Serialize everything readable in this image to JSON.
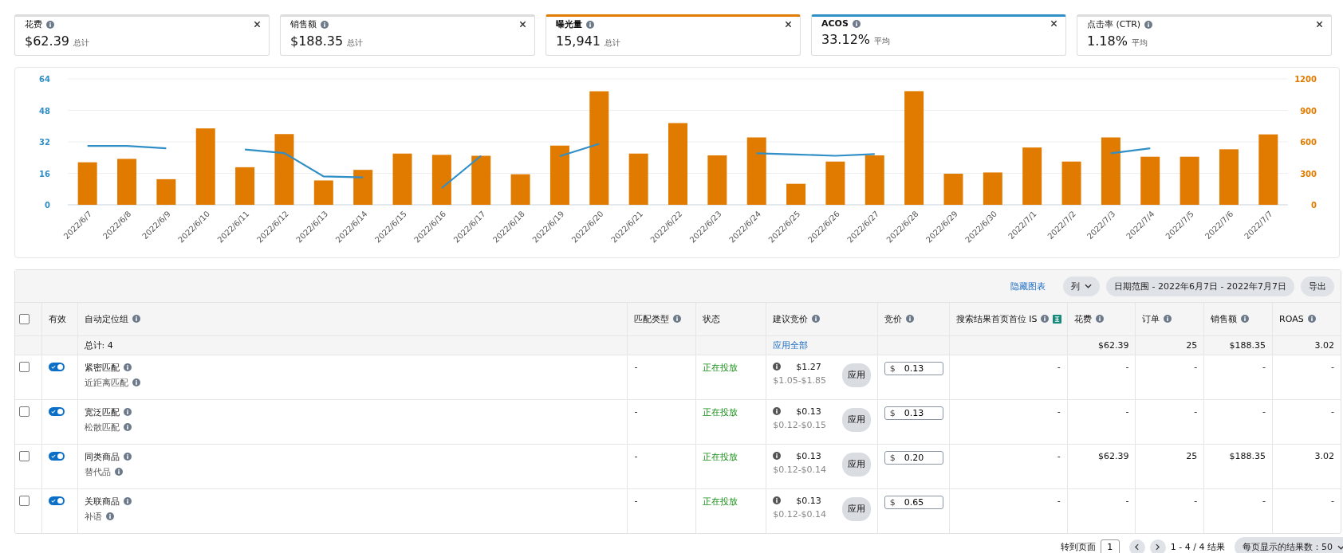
{
  "metrics": [
    {
      "label": "花费",
      "value": "$62.39",
      "note": "总计",
      "selected": false
    },
    {
      "label": "销售额",
      "value": "$188.35",
      "note": "总计",
      "selected": false
    },
    {
      "label": "曝光量",
      "value": "15,941",
      "note": "总计",
      "selected": true,
      "color": "#e07b00"
    },
    {
      "label": "ACOS",
      "value": "33.12%",
      "note": "平均",
      "selected": true,
      "color": "#2f8fc6"
    },
    {
      "label": "点击率 (CTR)",
      "value": "1.18%",
      "note": "平均",
      "selected": false
    }
  ],
  "chart": {
    "chart_data": {
      "type": "bar",
      "categories": [
        "2022/6/7",
        "2022/6/8",
        "2022/6/9",
        "2022/6/10",
        "2022/6/11",
        "2022/6/12",
        "2022/6/13",
        "2022/6/14",
        "2022/6/15",
        "2022/6/16",
        "2022/6/17",
        "2022/6/18",
        "2022/6/19",
        "2022/6/20",
        "2022/6/21",
        "2022/6/22",
        "2022/6/23",
        "2022/6/24",
        "2022/6/25",
        "2022/6/26",
        "2022/6/27",
        "2022/6/28",
        "2022/6/29",
        "2022/6/30",
        "2022/7/1",
        "2022/7/2",
        "2022/7/3",
        "2022/7/4",
        "2022/7/5",
        "2022/7/6",
        "2022/7/7"
      ],
      "series": [
        {
          "axis": "y2",
          "color": "#e07b00",
          "values": [
            405,
            438,
            244,
            728,
            358,
            674,
            232,
            333,
            488,
            476,
            467,
            291,
            564,
            1082,
            488,
            779,
            471,
            642,
            200,
            412,
            471,
            1083,
            296,
            308,
            546,
            412,
            642,
            458,
            458,
            529,
            671
          ]
        },
        {
          "type": "line",
          "axis": "y",
          "color": "#2f8fc6",
          "values": [
            29.9,
            29.9,
            28.7,
            null,
            28.1,
            26.3,
            14.4,
            13.9,
            null,
            8.5,
            24.9,
            null,
            24.7,
            31.0,
            null,
            null,
            null,
            26.2,
            25.6,
            24.9,
            25.8,
            null,
            null,
            null,
            null,
            null,
            26.2,
            28.7,
            null,
            null,
            null
          ]
        }
      ],
      "grid": true,
      "ylim": [
        0,
        64
      ],
      "y2lim": [
        0,
        1200
      ],
      "yticks": [
        0,
        16,
        32,
        48,
        64
      ],
      "y2ticks": [
        0,
        300,
        600,
        900,
        1200
      ]
    }
  },
  "toolbar": {
    "hide_chart": "隐藏图表",
    "columns": "列",
    "date_range": "日期范围 - 2022年6月7日 - 2022年7月7日",
    "export": "导出"
  },
  "table": {
    "columns": [
      {
        "label": "有效",
        "info": false
      },
      {
        "label": "自动定位组",
        "info": true
      },
      {
        "label": "匹配类型",
        "info": true
      },
      {
        "label": "状态",
        "info": false
      },
      {
        "label": "建议竞价",
        "info": true
      },
      {
        "label": "竞价",
        "info": true
      },
      {
        "label": "搜索结果首页首位 IS",
        "info": true
      },
      {
        "label": "花费",
        "info": true
      },
      {
        "label": "订单",
        "info": true
      },
      {
        "label": "销售额",
        "info": true
      },
      {
        "label": "ROAS",
        "info": true
      }
    ],
    "select_all_checked": false,
    "total": {
      "label": "总计: 4",
      "apply_all": "应用全部",
      "spend": "$62.39",
      "orders": "25",
      "sales": "$188.35",
      "roas": "3.02"
    },
    "rows": [
      {
        "checked": false,
        "enabled": true,
        "name": "紧密匹配",
        "sub": "近距离匹配",
        "match": "-",
        "status": "正在投放",
        "suggested": "$1.27",
        "range": "$1.05-$1.85",
        "apply": "应用",
        "currency": "$",
        "bid": "0.13",
        "is": "-",
        "spend": "-",
        "orders": "-",
        "sales": "-",
        "roas": "-"
      },
      {
        "checked": false,
        "enabled": true,
        "name": "宽泛匹配",
        "sub": "松散匹配",
        "match": "-",
        "status": "正在投放",
        "suggested": "$0.13",
        "range": "$0.12-$0.15",
        "apply": "应用",
        "currency": "$",
        "bid": "0.13",
        "is": "-",
        "spend": "-",
        "orders": "-",
        "sales": "-",
        "roas": "-"
      },
      {
        "checked": false,
        "enabled": true,
        "name": "同类商品",
        "sub": "替代品",
        "match": "-",
        "status": "正在投放",
        "suggested": "$0.13",
        "range": "$0.12-$0.14",
        "apply": "应用",
        "currency": "$",
        "bid": "0.20",
        "is": "-",
        "spend": "$62.39",
        "orders": "25",
        "sales": "$188.35",
        "roas": "3.02"
      },
      {
        "checked": false,
        "enabled": true,
        "name": "关联商品",
        "sub": "补语",
        "match": "-",
        "status": "正在投放",
        "suggested": "$0.13",
        "range": "$0.12-$0.14",
        "apply": "应用",
        "currency": "$",
        "bid": "0.65",
        "is": "-",
        "spend": "-",
        "orders": "-",
        "sales": "-",
        "roas": "-"
      }
    ]
  },
  "pagination": {
    "goto_label": "转到页面",
    "page": "1",
    "summary": "1 - 4 / 4 结果",
    "per_page": "每页显示的结果数：50"
  }
}
